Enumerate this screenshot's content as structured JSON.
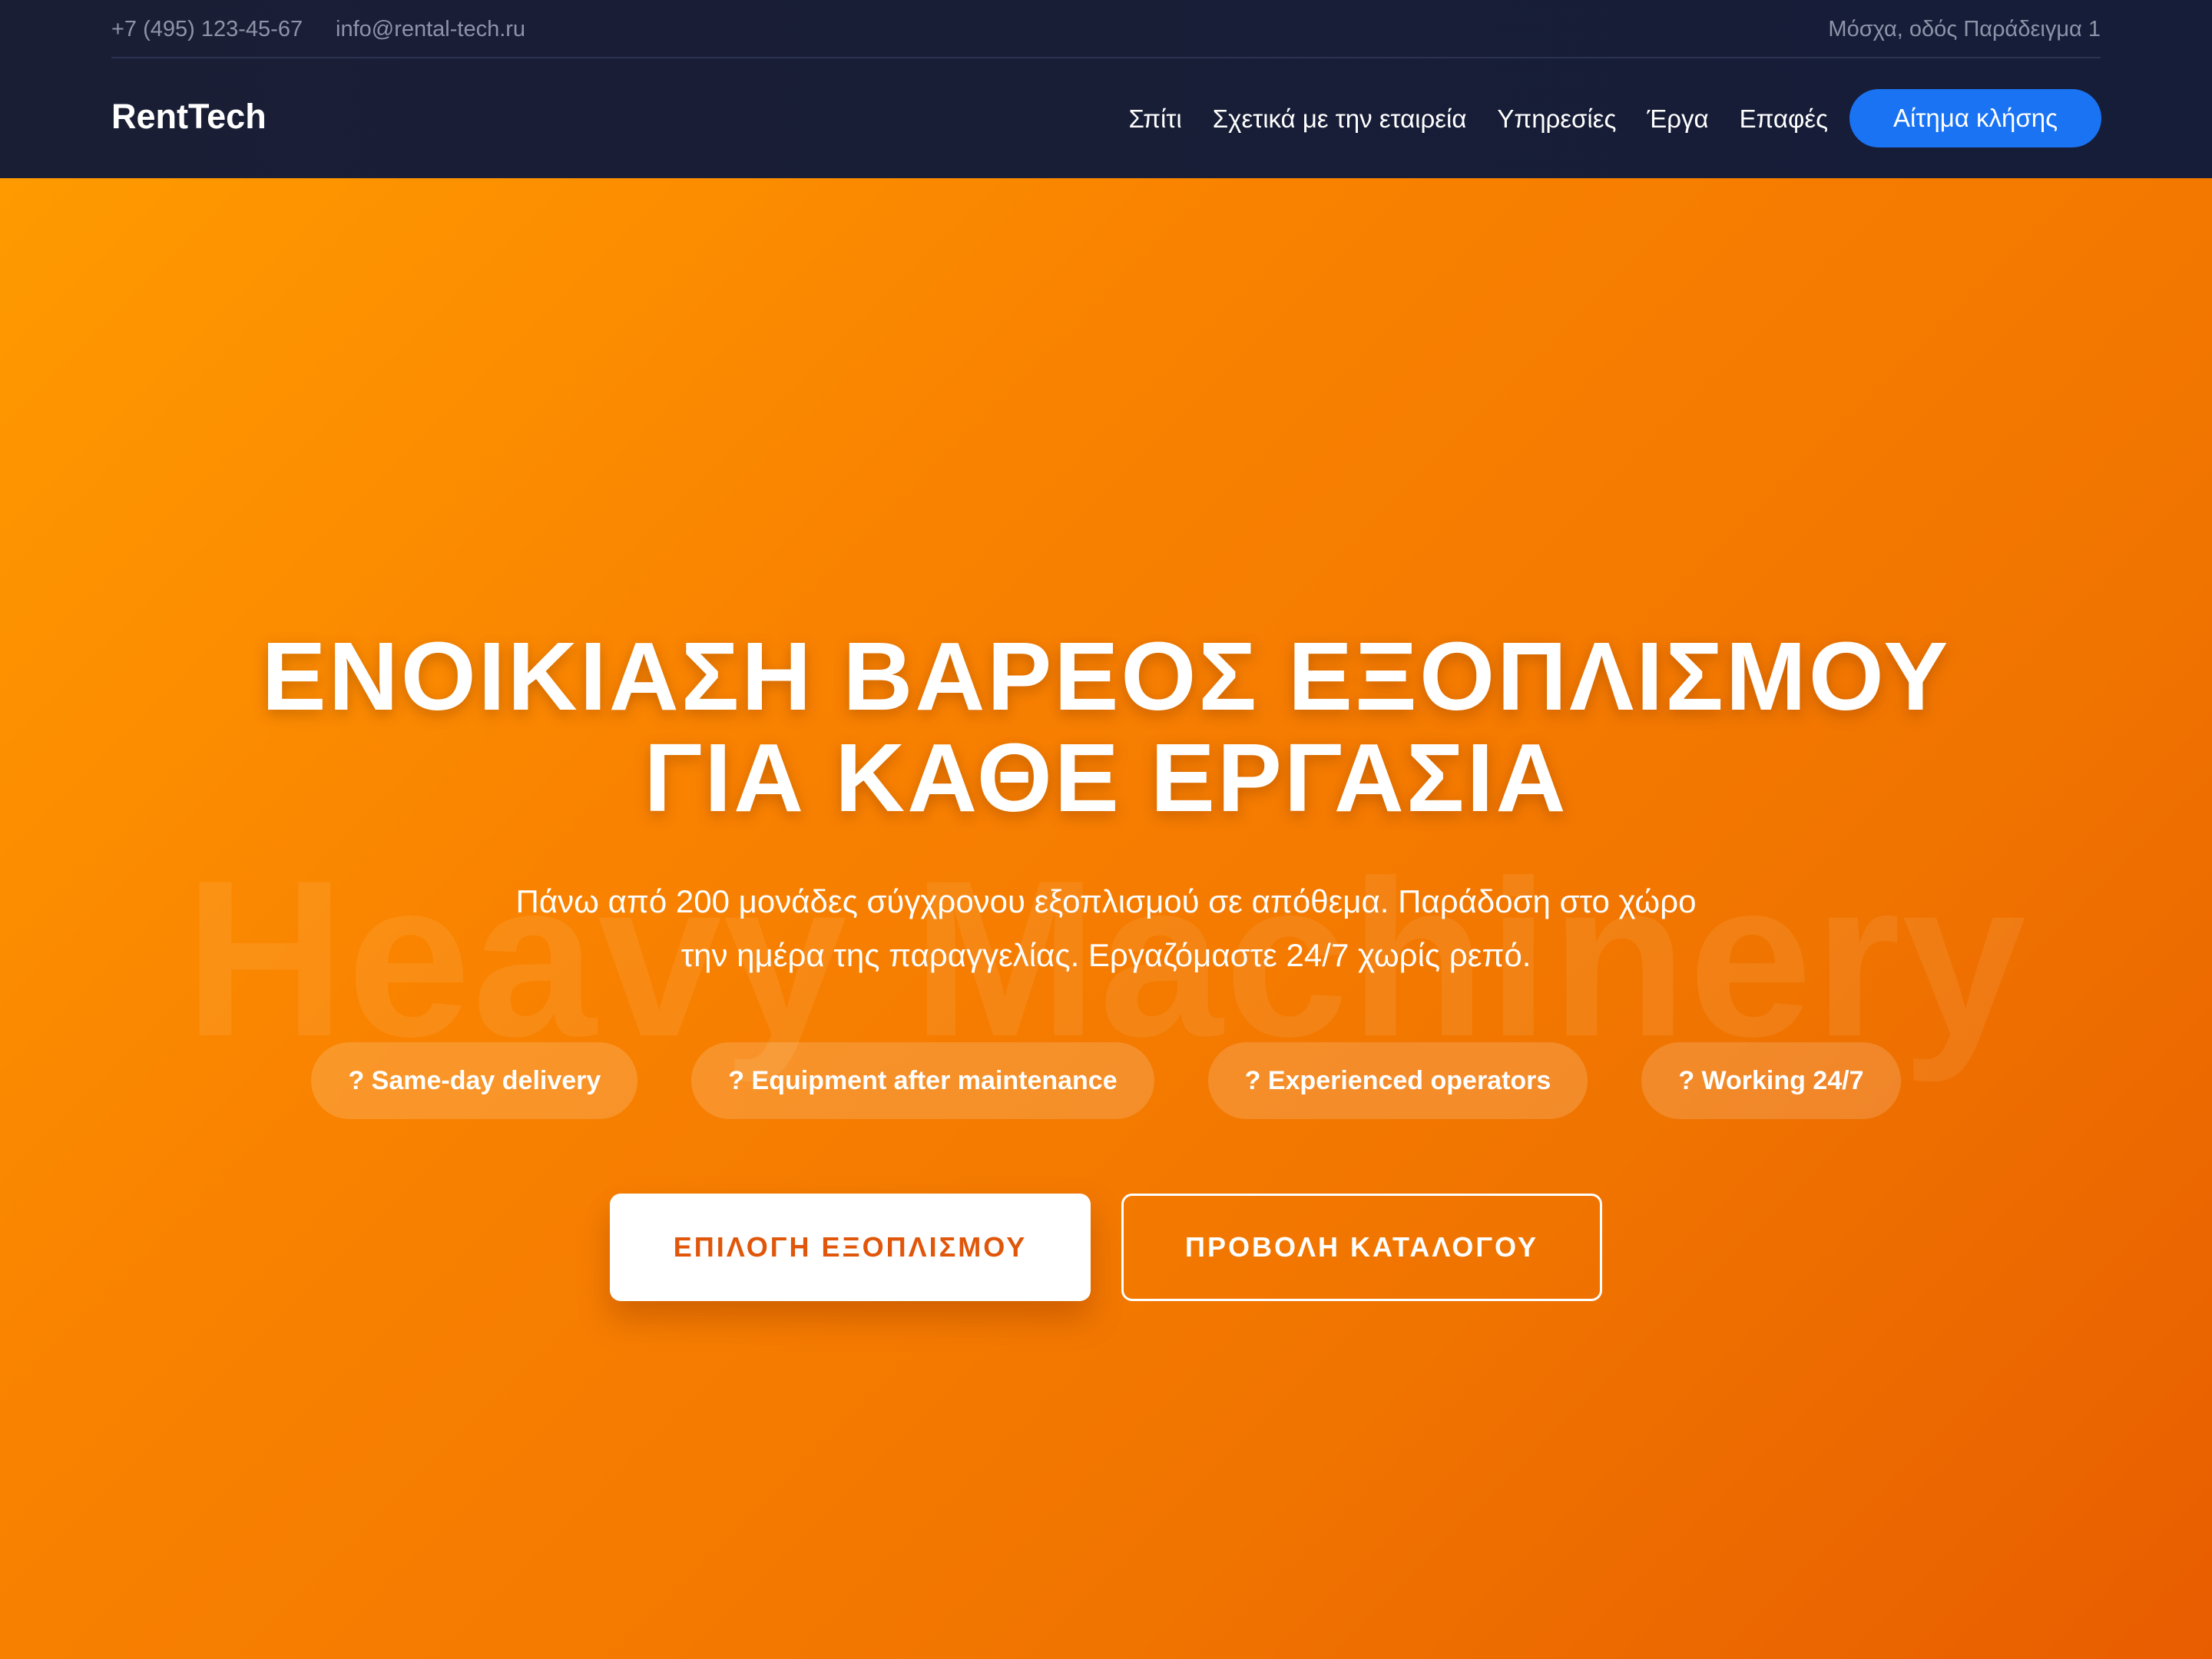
{
  "topbar": {
    "phone": "+7 (495) 123-45-67",
    "email": "info@rental-tech.ru",
    "address": "Μόσχα, οδός Παράδειγμα 1"
  },
  "header": {
    "logo": "RentTech",
    "nav": [
      "Σπίτι",
      "Σχετικά με την εταιρεία",
      "Υπηρεσίες",
      "Έργα",
      "Επαφές"
    ],
    "cta": "Αίτημα κλήσης"
  },
  "hero": {
    "watermark": "Heavy Machinery",
    "title_line1": "ΕΝΟΙΚΙΑΣΗ ΒΑΡΕΟΣ ΕΞΟΠΛΙΣΜΟΥ",
    "title_line2": "ΓΙΑ ΚΑΘΕ ΕΡΓΑΣΙΑ",
    "subtitle_line1": "Πάνω από 200 μονάδες σύγχρονου εξοπλισμού σε απόθεμα. Παράδοση στο χώρο",
    "subtitle_line2": "την ημέρα της παραγγελίας. Εργαζόμαστε 24/7 χωρίς ρεπό.",
    "features": [
      "? Same-day delivery",
      "? Equipment after maintenance",
      "? Experienced operators",
      "? Working 24/7"
    ],
    "primary_button": "ΕΠΙΛΟΓΗ ΕΞΟΠΛΙΣΜΟΥ",
    "secondary_button": "ΠΡΟΒΟΛΗ ΚΑΤΑΛΟΓΟΥ"
  },
  "colors": {
    "header_bg": "#1a1e35",
    "accent_blue": "#1a73f3",
    "hero_orange": "#fb8a00",
    "button_text": "#e0560a"
  }
}
